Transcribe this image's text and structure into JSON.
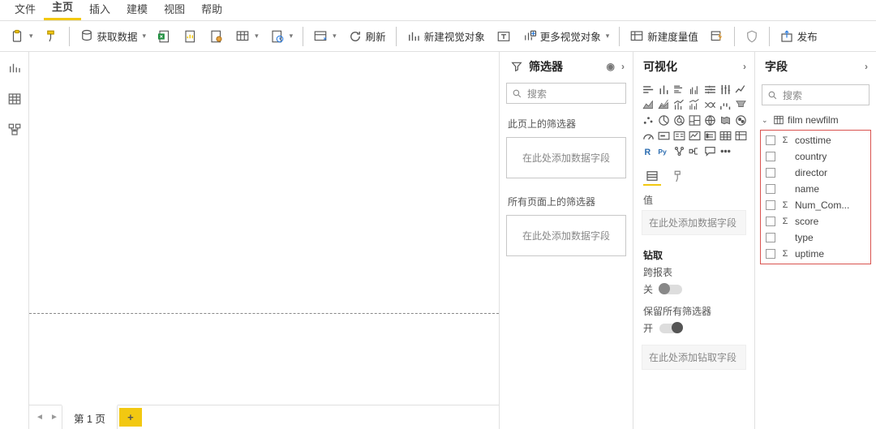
{
  "menu": {
    "tabs": [
      "文件",
      "主页",
      "插入",
      "建模",
      "视图",
      "帮助"
    ],
    "active": 1
  },
  "ribbon": {
    "get_data": "获取数据",
    "refresh": "刷新",
    "new_visual": "新建视觉对象",
    "more_visuals": "更多视觉对象",
    "new_measure": "新建度量值",
    "publish": "发布"
  },
  "filters": {
    "title": "筛选器",
    "search_ph": "搜索",
    "section_page": "此页上的筛选器",
    "section_all": "所有页面上的筛选器",
    "drop": "在此处添加数据字段"
  },
  "viz": {
    "title": "可视化",
    "value_label": "值",
    "value_drop": "在此处添加数据字段",
    "drill_title": "钻取",
    "cross": "跨报表",
    "off": "关",
    "keep": "保留所有筛选器",
    "on": "开",
    "drill_drop": "在此处添加钻取字段"
  },
  "fields": {
    "title": "字段",
    "search_ph": "搜索",
    "table": "film newfilm",
    "cols": [
      {
        "sigma": true,
        "name": "costtime"
      },
      {
        "sigma": false,
        "name": "country"
      },
      {
        "sigma": false,
        "name": "director"
      },
      {
        "sigma": false,
        "name": "name"
      },
      {
        "sigma": true,
        "name": "Num_Com..."
      },
      {
        "sigma": true,
        "name": "score"
      },
      {
        "sigma": false,
        "name": "type"
      },
      {
        "sigma": true,
        "name": "uptime"
      }
    ]
  },
  "page": {
    "tab": "第 1 页"
  }
}
